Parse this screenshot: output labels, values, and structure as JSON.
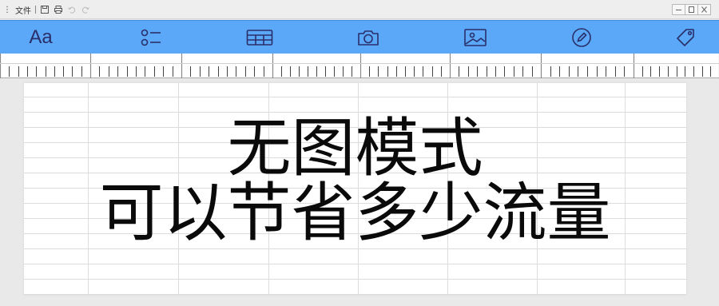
{
  "titlebar": {
    "menu_label": "文件",
    "controls": [
      "minimize",
      "maximize",
      "close"
    ]
  },
  "toolbar": {
    "background": "#5aa8f7",
    "icon_color": "#2a2f6a",
    "font_tool_label": "Aa",
    "tools": [
      "font-icon",
      "list-icon",
      "table-icon",
      "camera-icon",
      "image-icon",
      "edit-icon",
      "tag-icon"
    ]
  },
  "document": {
    "headline_line1": "无图模式",
    "headline_line2": "可以节省多少流量"
  }
}
